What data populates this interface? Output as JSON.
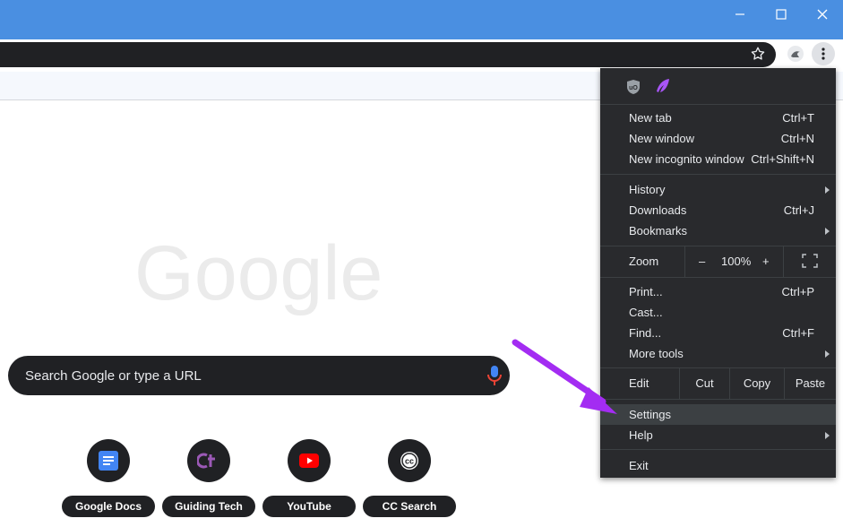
{
  "window": {
    "controls": {
      "minimize": "minimize-icon",
      "maximize": "maximize-icon",
      "close": "close-icon"
    }
  },
  "search": {
    "placeholder": "Search Google or type a URL"
  },
  "logo": {
    "text": "Google"
  },
  "shortcuts": [
    {
      "label": "Google Docs",
      "icon": "google-docs-icon",
      "color": "#4285f4"
    },
    {
      "label": "Guiding Tech",
      "icon": "guiding-tech-icon",
      "color": "#8e44ad"
    },
    {
      "label": "YouTube",
      "icon": "youtube-icon",
      "color": "#ff0000"
    },
    {
      "label": "CC Search",
      "icon": "cc-search-icon",
      "color": "#ffffff"
    }
  ],
  "menu": {
    "extension_icons": [
      "ublock-origin-icon",
      "feather-extension-icon"
    ],
    "group1": [
      {
        "label": "New tab",
        "shortcut": "Ctrl+T"
      },
      {
        "label": "New window",
        "shortcut": "Ctrl+N"
      },
      {
        "label": "New incognito window",
        "shortcut": "Ctrl+Shift+N"
      }
    ],
    "group2": [
      {
        "label": "History",
        "shortcut": ""
      },
      {
        "label": "Downloads",
        "shortcut": "Ctrl+J"
      },
      {
        "label": "Bookmarks",
        "shortcut": ""
      }
    ],
    "zoom": {
      "label": "Zoom",
      "minus": "–",
      "value": "100%",
      "plus": "+"
    },
    "group3": [
      {
        "label": "Print...",
        "shortcut": "Ctrl+P"
      },
      {
        "label": "Cast...",
        "shortcut": ""
      },
      {
        "label": "Find...",
        "shortcut": "Ctrl+F"
      },
      {
        "label": "More tools",
        "shortcut": ""
      }
    ],
    "edit": {
      "label": "Edit",
      "cut": "Cut",
      "copy": "Copy",
      "paste": "Paste"
    },
    "group4": [
      {
        "label": "Settings"
      },
      {
        "label": "Help"
      }
    ],
    "exit": {
      "label": "Exit"
    }
  },
  "colors": {
    "titlebar": "#4a8fe1",
    "menu_bg": "#292a2d",
    "highlight": "#3c4043",
    "arrow": "#a32cf2"
  }
}
